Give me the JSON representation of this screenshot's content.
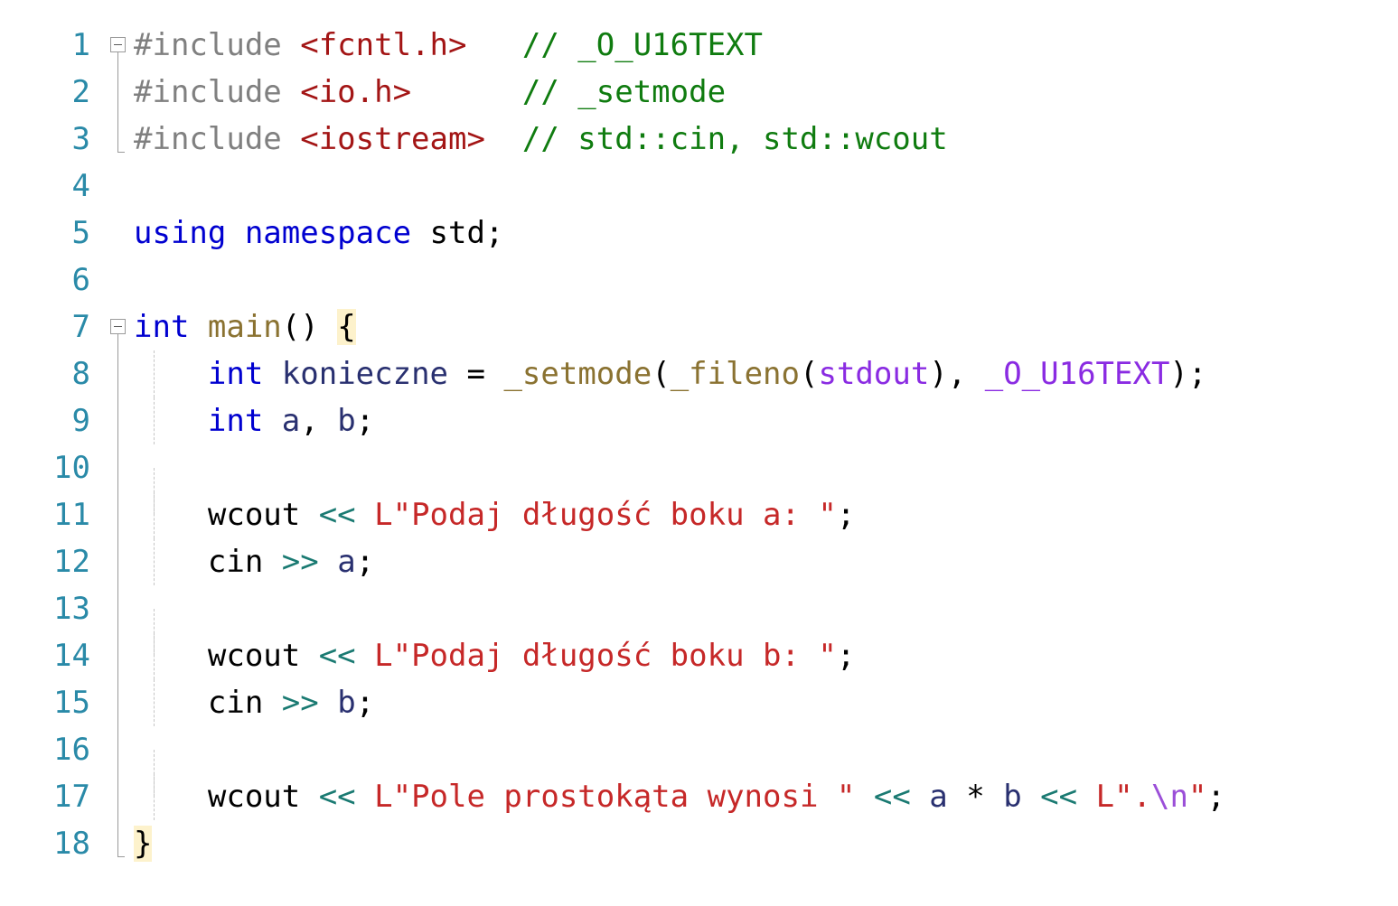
{
  "editor": {
    "language": "C++",
    "line_count": 18,
    "colors": {
      "background": "#ffffff",
      "line_number": "#2a8aa8",
      "preprocessor": "#808080",
      "header_name": "#a31515",
      "comment": "#107c10",
      "keyword": "#0000d0",
      "identifier": "#293070",
      "function": "#8a7231",
      "macro": "#8a2be2",
      "string": "#c62828",
      "escape": "#9b4fd8",
      "stream_operator": "#1a7a72",
      "brace_match_highlight": "#fdf2cc"
    },
    "gutter": {
      "fold_marker_icon": "collapse-minus-box-icon",
      "fold_markers_on_lines": [
        1,
        7
      ]
    },
    "line_numbers": [
      "1",
      "2",
      "3",
      "4",
      "5",
      "6",
      "7",
      "8",
      "9",
      "10",
      "11",
      "12",
      "13",
      "14",
      "15",
      "16",
      "17",
      "18"
    ],
    "lines": [
      {
        "number": "1",
        "fold": "marker-start",
        "indent_guide": false,
        "tokens": [
          {
            "t": "preproc",
            "v": "#include "
          },
          {
            "t": "header",
            "v": "<fcntl.h>"
          },
          {
            "t": "plain",
            "v": "   "
          },
          {
            "t": "comment",
            "v": "// _O_U16TEXT"
          }
        ]
      },
      {
        "number": "2",
        "fold": "line",
        "indent_guide": false,
        "tokens": [
          {
            "t": "preproc",
            "v": "#include "
          },
          {
            "t": "header",
            "v": "<io.h>"
          },
          {
            "t": "plain",
            "v": "      "
          },
          {
            "t": "comment",
            "v": "// _setmode"
          }
        ]
      },
      {
        "number": "3",
        "fold": "tail",
        "indent_guide": false,
        "tokens": [
          {
            "t": "preproc",
            "v": "#include "
          },
          {
            "t": "header",
            "v": "<iostream>"
          },
          {
            "t": "plain",
            "v": "  "
          },
          {
            "t": "comment",
            "v": "// std::cin, std::wcout"
          }
        ]
      },
      {
        "number": "4",
        "fold": "none",
        "indent_guide": false,
        "tokens": []
      },
      {
        "number": "5",
        "fold": "none",
        "indent_guide": false,
        "tokens": [
          {
            "t": "keyword",
            "v": "using namespace "
          },
          {
            "t": "plain",
            "v": "std;"
          }
        ]
      },
      {
        "number": "6",
        "fold": "none",
        "indent_guide": false,
        "tokens": []
      },
      {
        "number": "7",
        "fold": "marker-start",
        "indent_guide": false,
        "tokens": [
          {
            "t": "keyword",
            "v": "int "
          },
          {
            "t": "func",
            "v": "main"
          },
          {
            "t": "plain",
            "v": "() "
          },
          {
            "t": "brace",
            "v": "{"
          }
        ]
      },
      {
        "number": "8",
        "fold": "line",
        "indent_guide": true,
        "tokens": [
          {
            "t": "plain",
            "v": "    "
          },
          {
            "t": "keyword",
            "v": "int "
          },
          {
            "t": "ident",
            "v": "konieczne"
          },
          {
            "t": "plain",
            "v": " = "
          },
          {
            "t": "func",
            "v": "_setmode"
          },
          {
            "t": "plain",
            "v": "("
          },
          {
            "t": "func",
            "v": "_fileno"
          },
          {
            "t": "plain",
            "v": "("
          },
          {
            "t": "macro",
            "v": "stdout"
          },
          {
            "t": "plain",
            "v": "), "
          },
          {
            "t": "macro",
            "v": "_O_U16TEXT"
          },
          {
            "t": "plain",
            "v": ");"
          }
        ]
      },
      {
        "number": "9",
        "fold": "line",
        "indent_guide": true,
        "tokens": [
          {
            "t": "plain",
            "v": "    "
          },
          {
            "t": "keyword",
            "v": "int "
          },
          {
            "t": "ident",
            "v": "a"
          },
          {
            "t": "plain",
            "v": ", "
          },
          {
            "t": "ident",
            "v": "b"
          },
          {
            "t": "plain",
            "v": ";"
          }
        ]
      },
      {
        "number": "10",
        "fold": "line",
        "indent_guide": true,
        "tokens": []
      },
      {
        "number": "11",
        "fold": "line",
        "indent_guide": true,
        "tokens": [
          {
            "t": "plain",
            "v": "    wcout "
          },
          {
            "t": "operator",
            "v": "<<"
          },
          {
            "t": "plain",
            "v": " "
          },
          {
            "t": "string",
            "v": "L\"Podaj długość boku a: \""
          },
          {
            "t": "plain",
            "v": ";"
          }
        ]
      },
      {
        "number": "12",
        "fold": "line",
        "indent_guide": true,
        "tokens": [
          {
            "t": "plain",
            "v": "    cin "
          },
          {
            "t": "operator",
            "v": ">>"
          },
          {
            "t": "plain",
            "v": " "
          },
          {
            "t": "ident",
            "v": "a"
          },
          {
            "t": "plain",
            "v": ";"
          }
        ]
      },
      {
        "number": "13",
        "fold": "line",
        "indent_guide": true,
        "tokens": []
      },
      {
        "number": "14",
        "fold": "line",
        "indent_guide": true,
        "tokens": [
          {
            "t": "plain",
            "v": "    wcout "
          },
          {
            "t": "operator",
            "v": "<<"
          },
          {
            "t": "plain",
            "v": " "
          },
          {
            "t": "string",
            "v": "L\"Podaj długość boku b: \""
          },
          {
            "t": "plain",
            "v": ";"
          }
        ]
      },
      {
        "number": "15",
        "fold": "line",
        "indent_guide": true,
        "tokens": [
          {
            "t": "plain",
            "v": "    cin "
          },
          {
            "t": "operator",
            "v": ">>"
          },
          {
            "t": "plain",
            "v": " "
          },
          {
            "t": "ident",
            "v": "b"
          },
          {
            "t": "plain",
            "v": ";"
          }
        ]
      },
      {
        "number": "16",
        "fold": "line",
        "indent_guide": true,
        "tokens": []
      },
      {
        "number": "17",
        "fold": "line",
        "indent_guide": true,
        "tokens": [
          {
            "t": "plain",
            "v": "    wcout "
          },
          {
            "t": "operator",
            "v": "<<"
          },
          {
            "t": "plain",
            "v": " "
          },
          {
            "t": "string",
            "v": "L\"Pole prostokąta wynosi \""
          },
          {
            "t": "plain",
            "v": " "
          },
          {
            "t": "operator",
            "v": "<<"
          },
          {
            "t": "plain",
            "v": " "
          },
          {
            "t": "ident",
            "v": "a"
          },
          {
            "t": "plain",
            "v": " * "
          },
          {
            "t": "ident",
            "v": "b"
          },
          {
            "t": "plain",
            "v": " "
          },
          {
            "t": "operator",
            "v": "<<"
          },
          {
            "t": "plain",
            "v": " "
          },
          {
            "t": "string",
            "v": "L\"."
          },
          {
            "t": "escape",
            "v": "\\n"
          },
          {
            "t": "string",
            "v": "\""
          },
          {
            "t": "plain",
            "v": ";"
          }
        ]
      },
      {
        "number": "18",
        "fold": "tail",
        "indent_guide": false,
        "tokens": [
          {
            "t": "brace",
            "v": "}"
          }
        ]
      }
    ]
  }
}
